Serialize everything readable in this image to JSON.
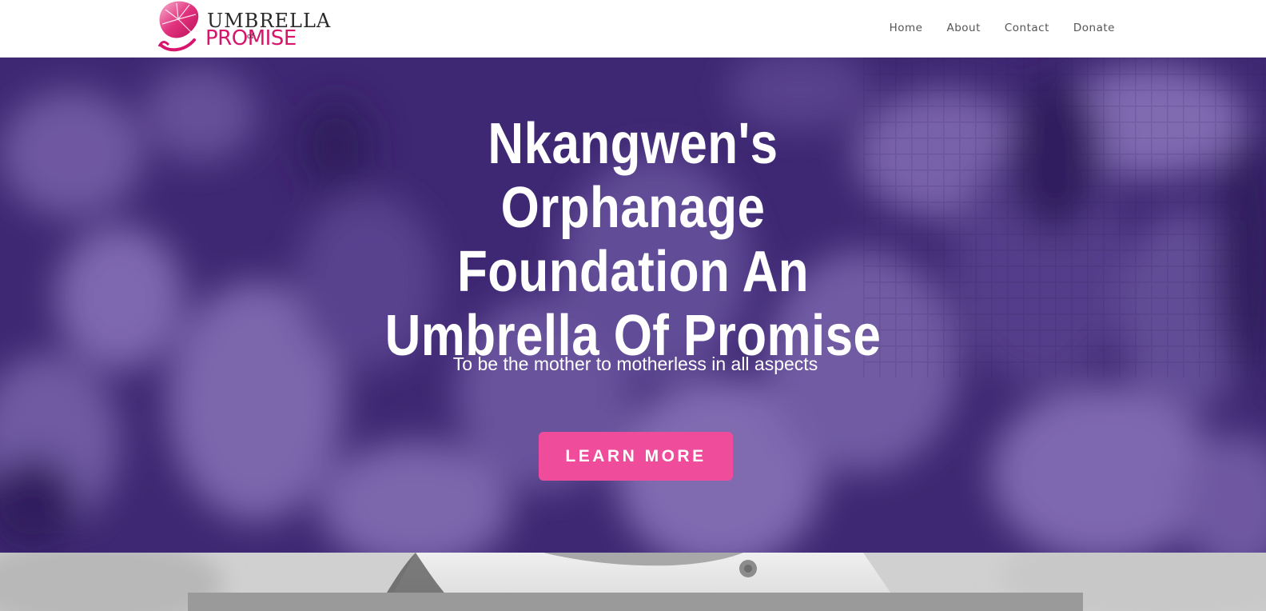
{
  "header": {
    "logo": {
      "line1": "UMBRELLA",
      "of": "of",
      "line2": "PROMISE",
      "color": "#d6156c"
    },
    "nav": [
      "Home",
      "About",
      "Contact",
      "Donate"
    ]
  },
  "hero": {
    "title": "Nkangwen's Orphanage Foundation An Umbrella Of Promise",
    "subtitle": "To be the mother to motherless in all aspects",
    "button_label": "LEARN MORE",
    "overlay_color": "#3d2570",
    "button_color": "#ef4c9b"
  }
}
